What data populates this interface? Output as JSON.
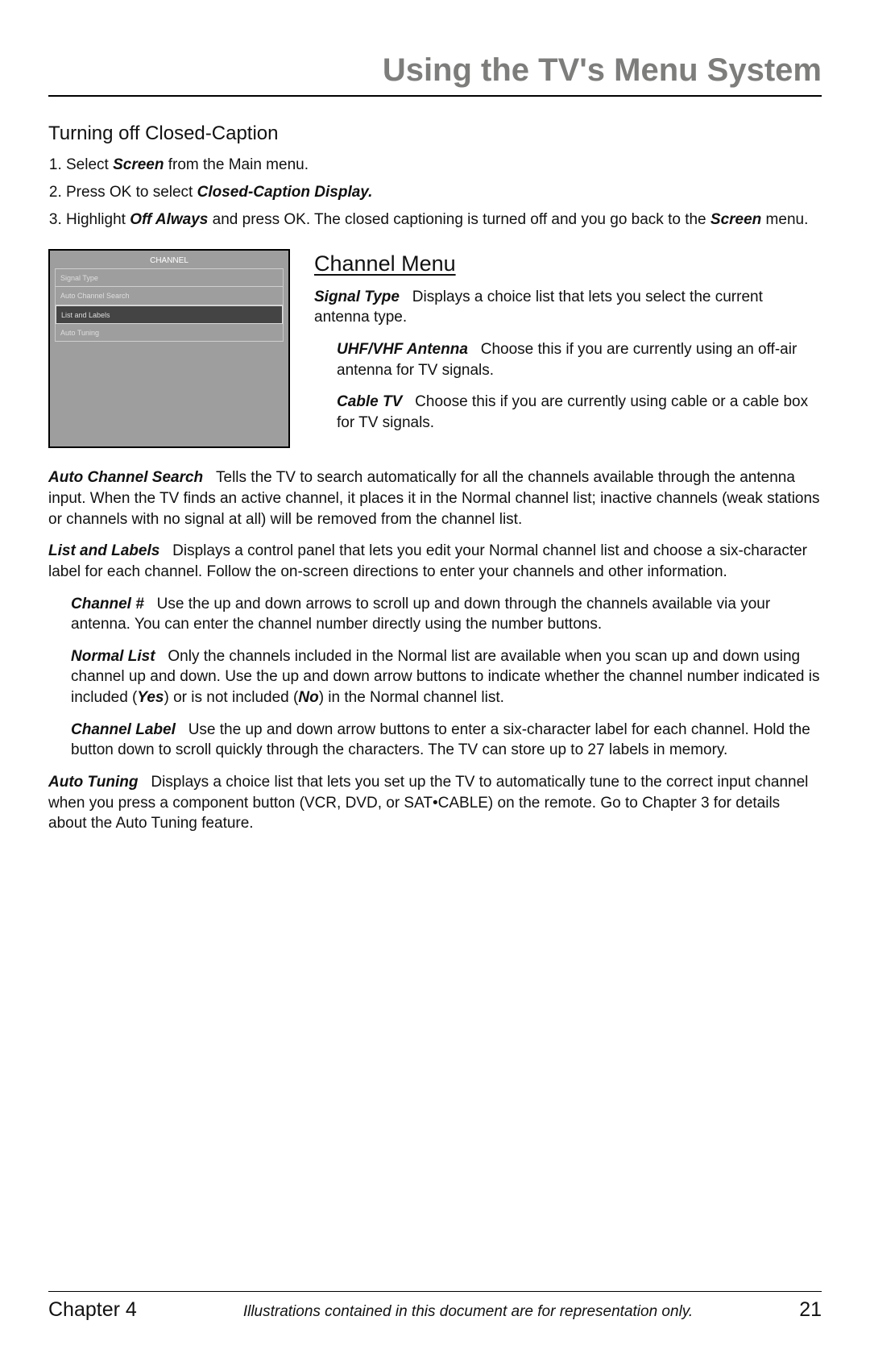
{
  "chapter_title": "Using the TV's Menu System",
  "section1": {
    "heading": "Turning off Closed-Caption",
    "steps": [
      {
        "prefix": "Select ",
        "em": "Screen",
        "suffix": " from the Main menu."
      },
      {
        "prefix": "Press OK to select ",
        "em": "Closed-Caption Display.",
        "suffix": ""
      },
      {
        "prefix": "Highlight ",
        "em": "Off Always",
        "suffix": " and press OK. The closed captioning is turned off and you go back to the ",
        "em2": "Screen",
        "tail": " menu."
      }
    ]
  },
  "tvshot": {
    "header": "CHANNEL",
    "items": [
      "Signal Type",
      "Auto Channel Search",
      "List and Labels",
      "Auto Tuning"
    ]
  },
  "channel": {
    "heading": "Channel Menu",
    "signal_type_label": "Signal Type",
    "signal_type_text": "Displays a choice list that lets you select the current antenna type.",
    "uhf_label": "UHF/VHF Antenna",
    "uhf_text": "Choose this if you are currently using an off-air antenna for TV signals.",
    "cable_label": "Cable TV",
    "cable_text": "Choose this if you are currently using cable or a cable box for TV signals.",
    "auto_search_label": "Auto Channel Search",
    "auto_search_text": "Tells the TV to search automatically for all the channels available through the antenna input. When the TV finds an active channel, it places it in the Normal channel list; inactive channels (weak stations or channels with no signal at all) will be removed from the channel list.",
    "list_label": "List and Labels",
    "list_text": "Displays a control panel that lets you edit your Normal channel list and choose a six-character label for each channel. Follow the on-screen directions to enter your channels and other information.",
    "chnum_label": "Channel #",
    "chnum_text": "Use the up and down arrows to scroll up and down through the channels available via your antenna. You can enter the channel number directly using the number buttons.",
    "normal_label": "Normal List",
    "normal_text_a": "Only the channels included in the Normal list are available when you scan up and down using channel up and down. Use the up and down arrow buttons to indicate whether the channel number indicated is included (",
    "normal_yes": "Yes",
    "normal_text_b": ") or is not included (",
    "normal_no": "No",
    "normal_text_c": ") in the Normal channel list.",
    "chlabel_label": "Channel Label",
    "chlabel_text": "Use the up and down arrow buttons to enter a six-character label for each channel. Hold the button down to scroll quickly through the characters. The TV can store up to 27 labels in memory.",
    "autotune_label": "Auto Tuning",
    "autotune_text": "Displays a choice list that lets you set up the TV to automatically tune to the correct input channel when you press a component button (VCR, DVD, or SAT•CABLE) on the remote. Go to Chapter 3 for details about the Auto Tuning feature."
  },
  "footer": {
    "chapter": "Chapter 4",
    "note": "Illustrations contained in this document are for representation only.",
    "page": "21"
  }
}
